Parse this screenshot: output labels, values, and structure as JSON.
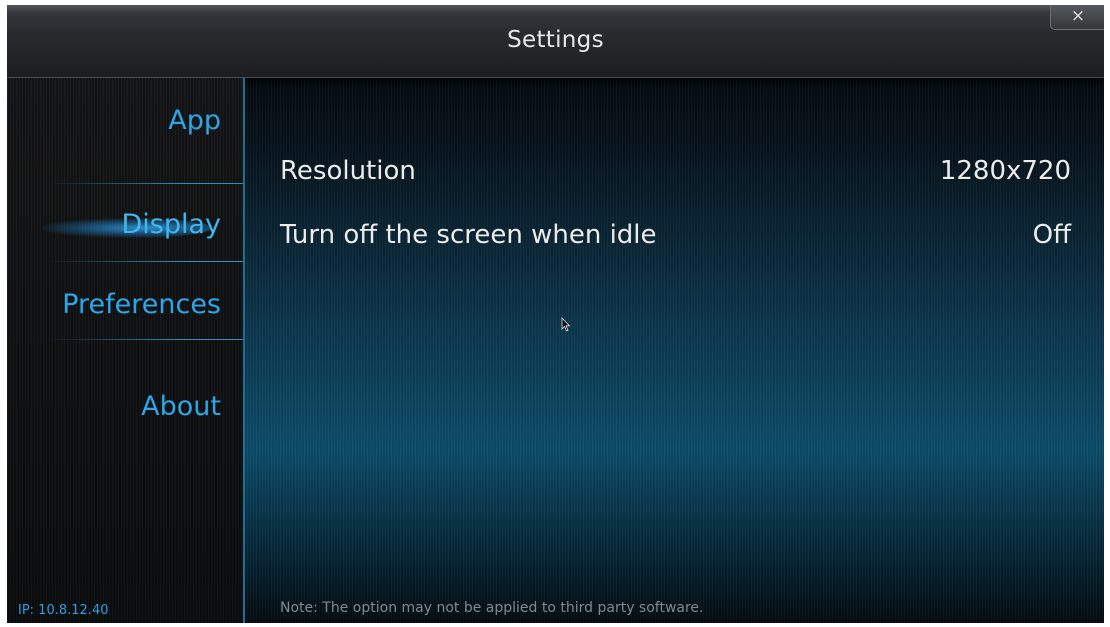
{
  "window": {
    "title": "Settings",
    "close_symbol": "×"
  },
  "sidebar": {
    "items": [
      {
        "label": "App",
        "active": false
      },
      {
        "label": "Display",
        "active": true
      },
      {
        "label": "Preferences",
        "active": false
      },
      {
        "label": "About",
        "active": false
      }
    ],
    "ip_text": "IP: 10.8.12.40"
  },
  "content": {
    "settings": [
      {
        "label": "Resolution",
        "value": "1280x720"
      },
      {
        "label": "Turn off the screen when idle",
        "value": "Off"
      }
    ],
    "note": "Note: The option may not be applied to third party software."
  },
  "colors": {
    "accent": "#2ea6e6",
    "divider": "#2f8fbf",
    "text": "#ececec"
  }
}
